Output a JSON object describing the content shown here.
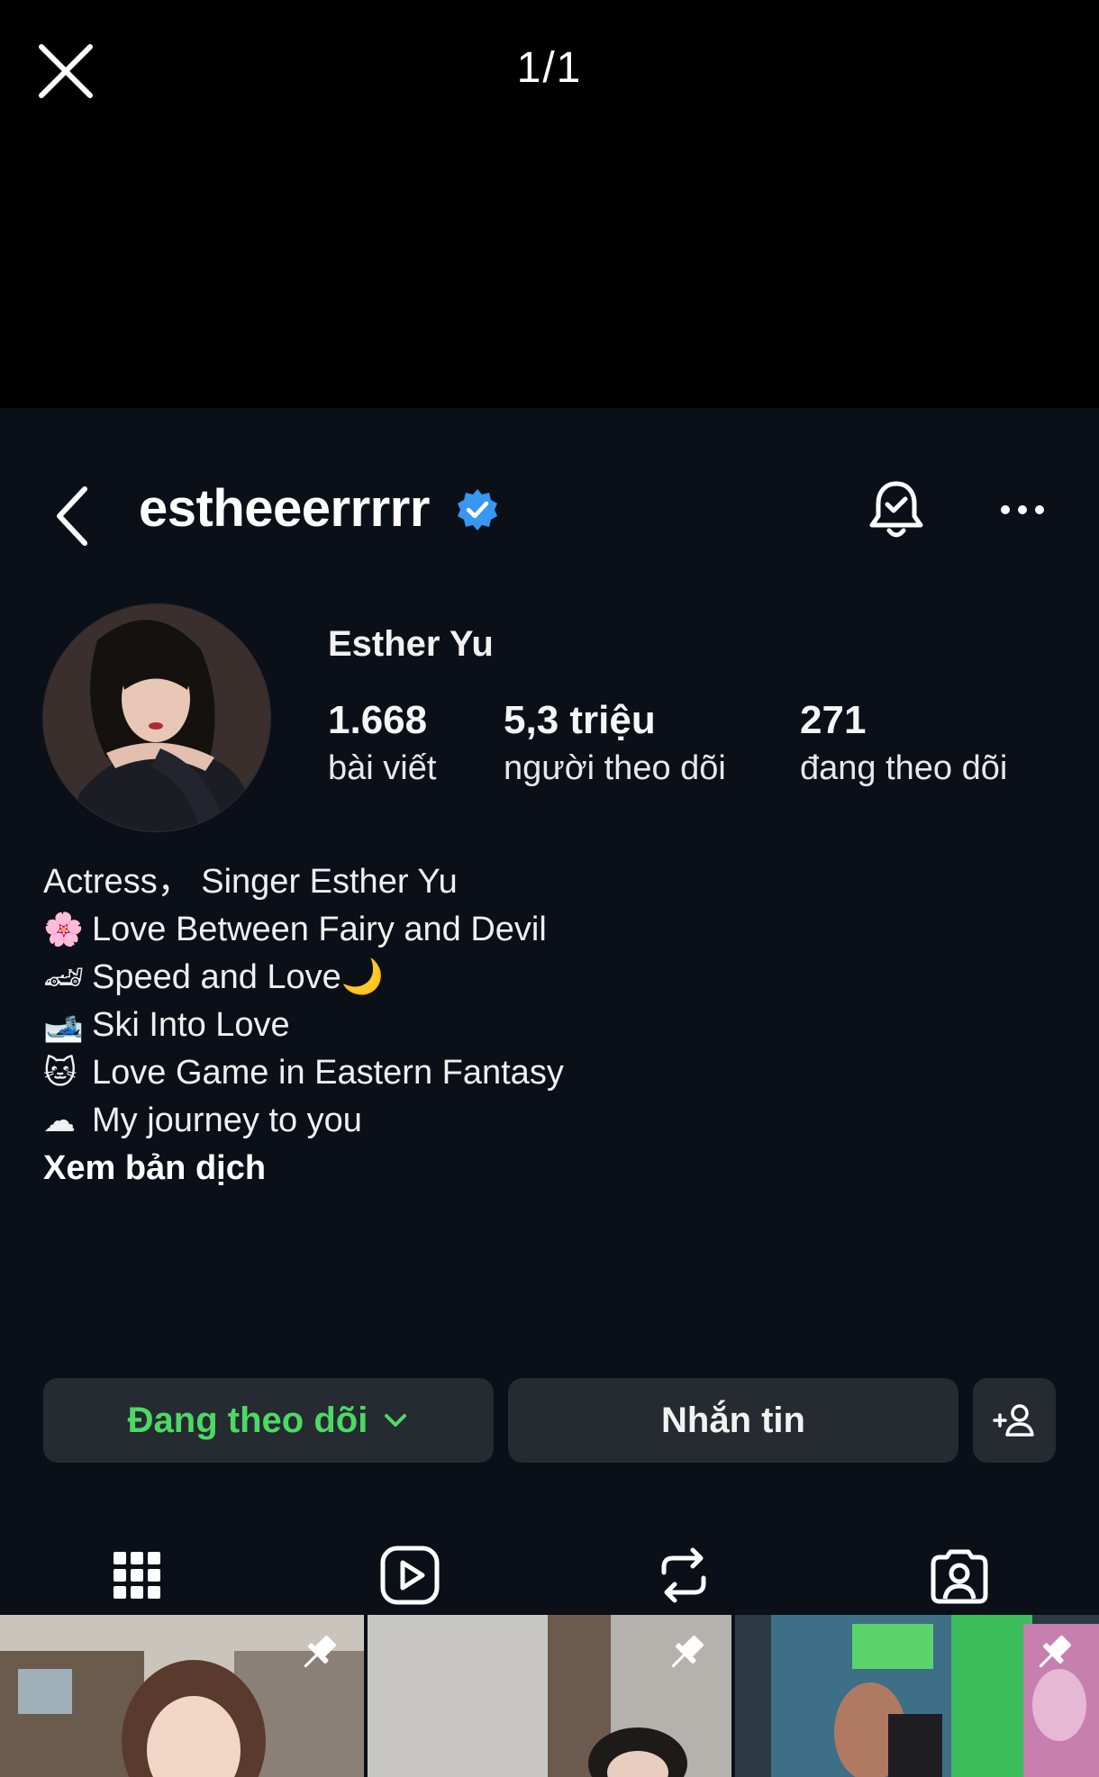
{
  "viewer": {
    "counter": "1/1"
  },
  "profile": {
    "username": "estheeerrrrr",
    "display_name": "Esther Yu",
    "stats": [
      {
        "value": "1.668",
        "label": "bài viết"
      },
      {
        "value": "5,3 triệu",
        "label": "người theo dõi"
      },
      {
        "value": "271",
        "label": "đang theo dõi"
      }
    ],
    "bio_lines": [
      {
        "emoji": "",
        "text": "Actress， Singer Esther Yu"
      },
      {
        "emoji": "🌸",
        "text": "Love Between Fairy and Devil"
      },
      {
        "emoji": "🏎",
        "text": "Speed and Love🌙"
      },
      {
        "emoji": "🎿",
        "text": "Ski Into Love"
      },
      {
        "emoji": "🐱",
        "text": "Love Game in Eastern Fantasy"
      },
      {
        "emoji": "☁",
        "text": "My journey to you"
      }
    ],
    "translate_label": "Xem bản dịch"
  },
  "actions": {
    "following_label": "Đang theo dõi",
    "message_label": "Nhắn tin"
  },
  "tabs": [
    {
      "icon": "grid-icon",
      "active": true
    },
    {
      "icon": "reels-icon",
      "active": false
    },
    {
      "icon": "reposts-icon",
      "active": false
    },
    {
      "icon": "tagged-icon",
      "active": false
    }
  ],
  "colors": {
    "screen_bg": "#0b0f17",
    "button_bg": "#262a31",
    "following_green": "#4cd964",
    "verified_blue": "#3897f0"
  }
}
